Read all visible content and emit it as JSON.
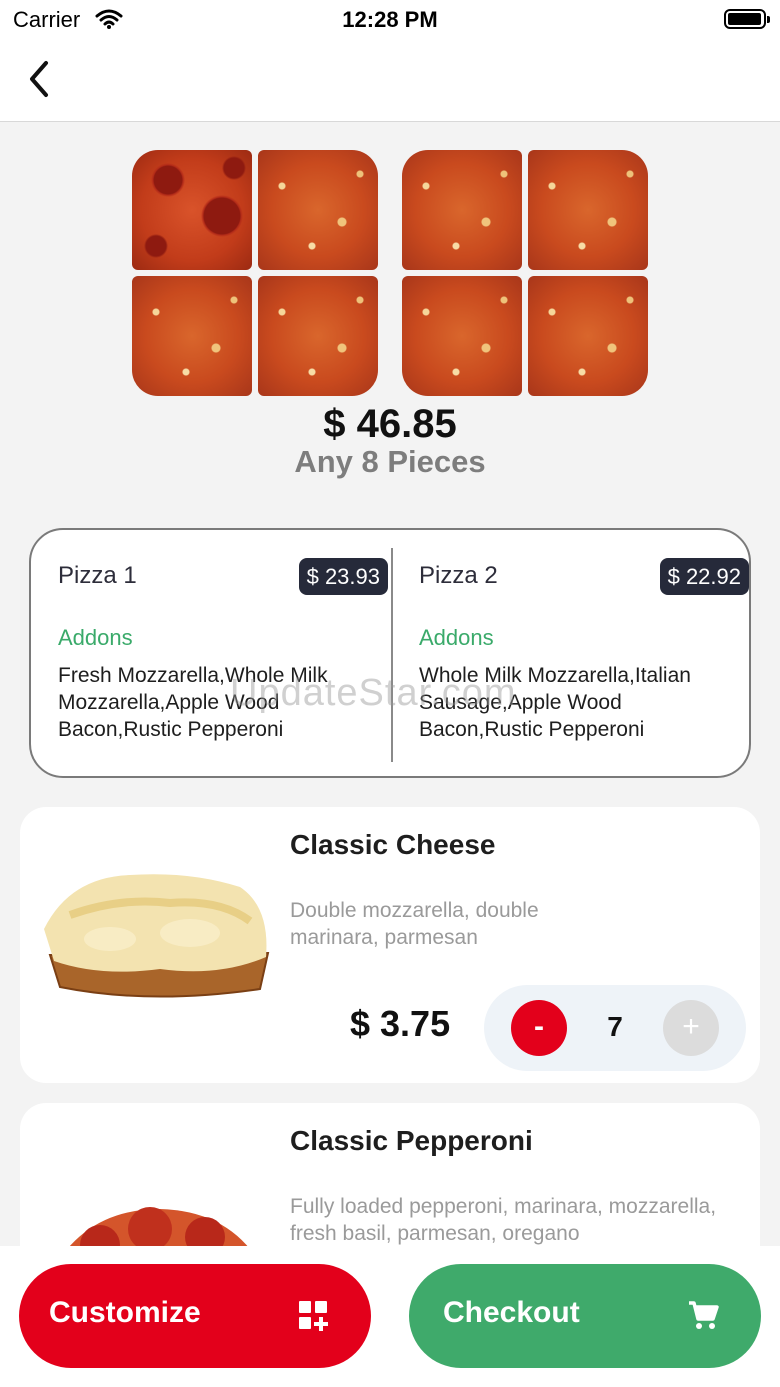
{
  "status_bar": {
    "carrier": "Carrier",
    "time": "12:28 PM"
  },
  "order": {
    "total_price": "$ 46.85",
    "pieces_label": "Any 8 Pieces"
  },
  "summary": {
    "pizzas": [
      {
        "name": "Pizza 1",
        "price": "$ 23.93",
        "addons_title": "Addons",
        "addons": "Fresh Mozzarella,Whole Milk Mozzarella,Apple Wood Bacon,Rustic Pepperoni"
      },
      {
        "name": "Pizza 2",
        "price": "$ 22.92",
        "addons_title": "Addons",
        "addons": "Whole Milk Mozzarella,Italian Sausage,Apple Wood Bacon,Rustic Pepperoni"
      }
    ]
  },
  "watermark": "UpdateStar.com",
  "products": [
    {
      "title": "Classic Cheese",
      "description": "Double mozzarella, double marinara, parmesan",
      "price": "$ 3.75",
      "quantity": "7",
      "minus_label": "-",
      "plus_label": "+"
    },
    {
      "title": "Classic Pepperoni",
      "description": "Fully loaded pepperoni, marinara, mozzarella, fresh basil, parmesan, oregano"
    }
  ],
  "actions": {
    "customize_label": "Customize",
    "checkout_label": "Checkout"
  },
  "colors": {
    "primary_red": "#e3001b",
    "primary_green": "#3faa6b",
    "badge_dark": "#262a3a",
    "addons_green": "#3aaa6a"
  },
  "icons": {
    "back": "chevron-left-icon",
    "wifi": "wifi-icon",
    "battery": "battery-icon",
    "customize": "grid-plus-icon",
    "checkout": "cart-icon"
  }
}
